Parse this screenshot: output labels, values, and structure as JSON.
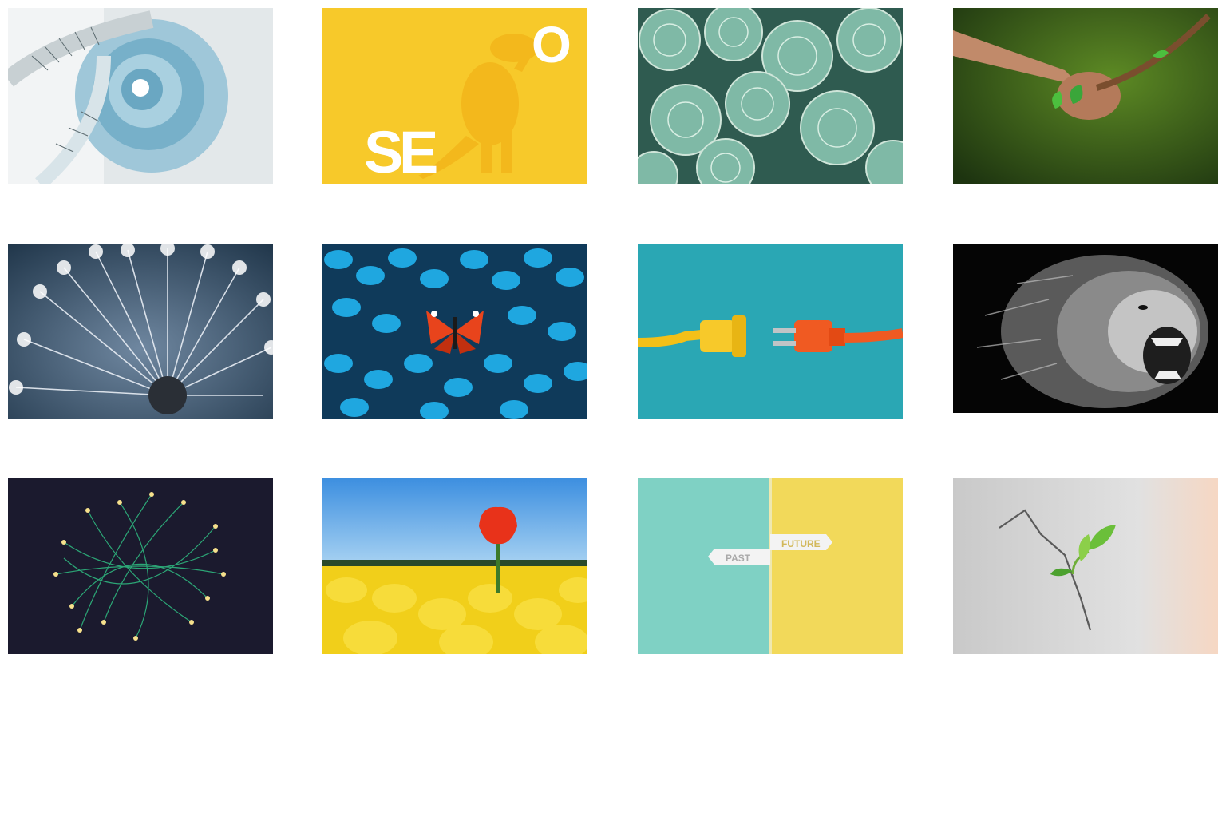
{
  "gallery": {
    "tiles": [
      {
        "icon": "spiral-staircase-image"
      },
      {
        "icon": "dinosaur-seo-image",
        "letters": [
          "S",
          "E",
          "O"
        ]
      },
      {
        "icon": "succulents-image"
      },
      {
        "icon": "hand-holding-branch-image"
      },
      {
        "icon": "dandelion-seeds-image"
      },
      {
        "icon": "butterflies-image"
      },
      {
        "icon": "power-plugs-image"
      },
      {
        "icon": "roaring-lion-image"
      },
      {
        "icon": "fiber-optic-sphere-image"
      },
      {
        "icon": "red-tulip-in-yellow-field-image"
      },
      {
        "icon": "past-future-signs-image",
        "signs": {
          "past": "PAST",
          "future": "FUTURE"
        }
      },
      {
        "icon": "sprout-from-crack-image"
      }
    ]
  },
  "colors": {
    "page_background": "#ffffff",
    "seo_yellow": "#f7c92a",
    "plug_teal": "#2aa7b4",
    "past_mint": "#7fd1c4",
    "future_yellow": "#f2d95a"
  }
}
